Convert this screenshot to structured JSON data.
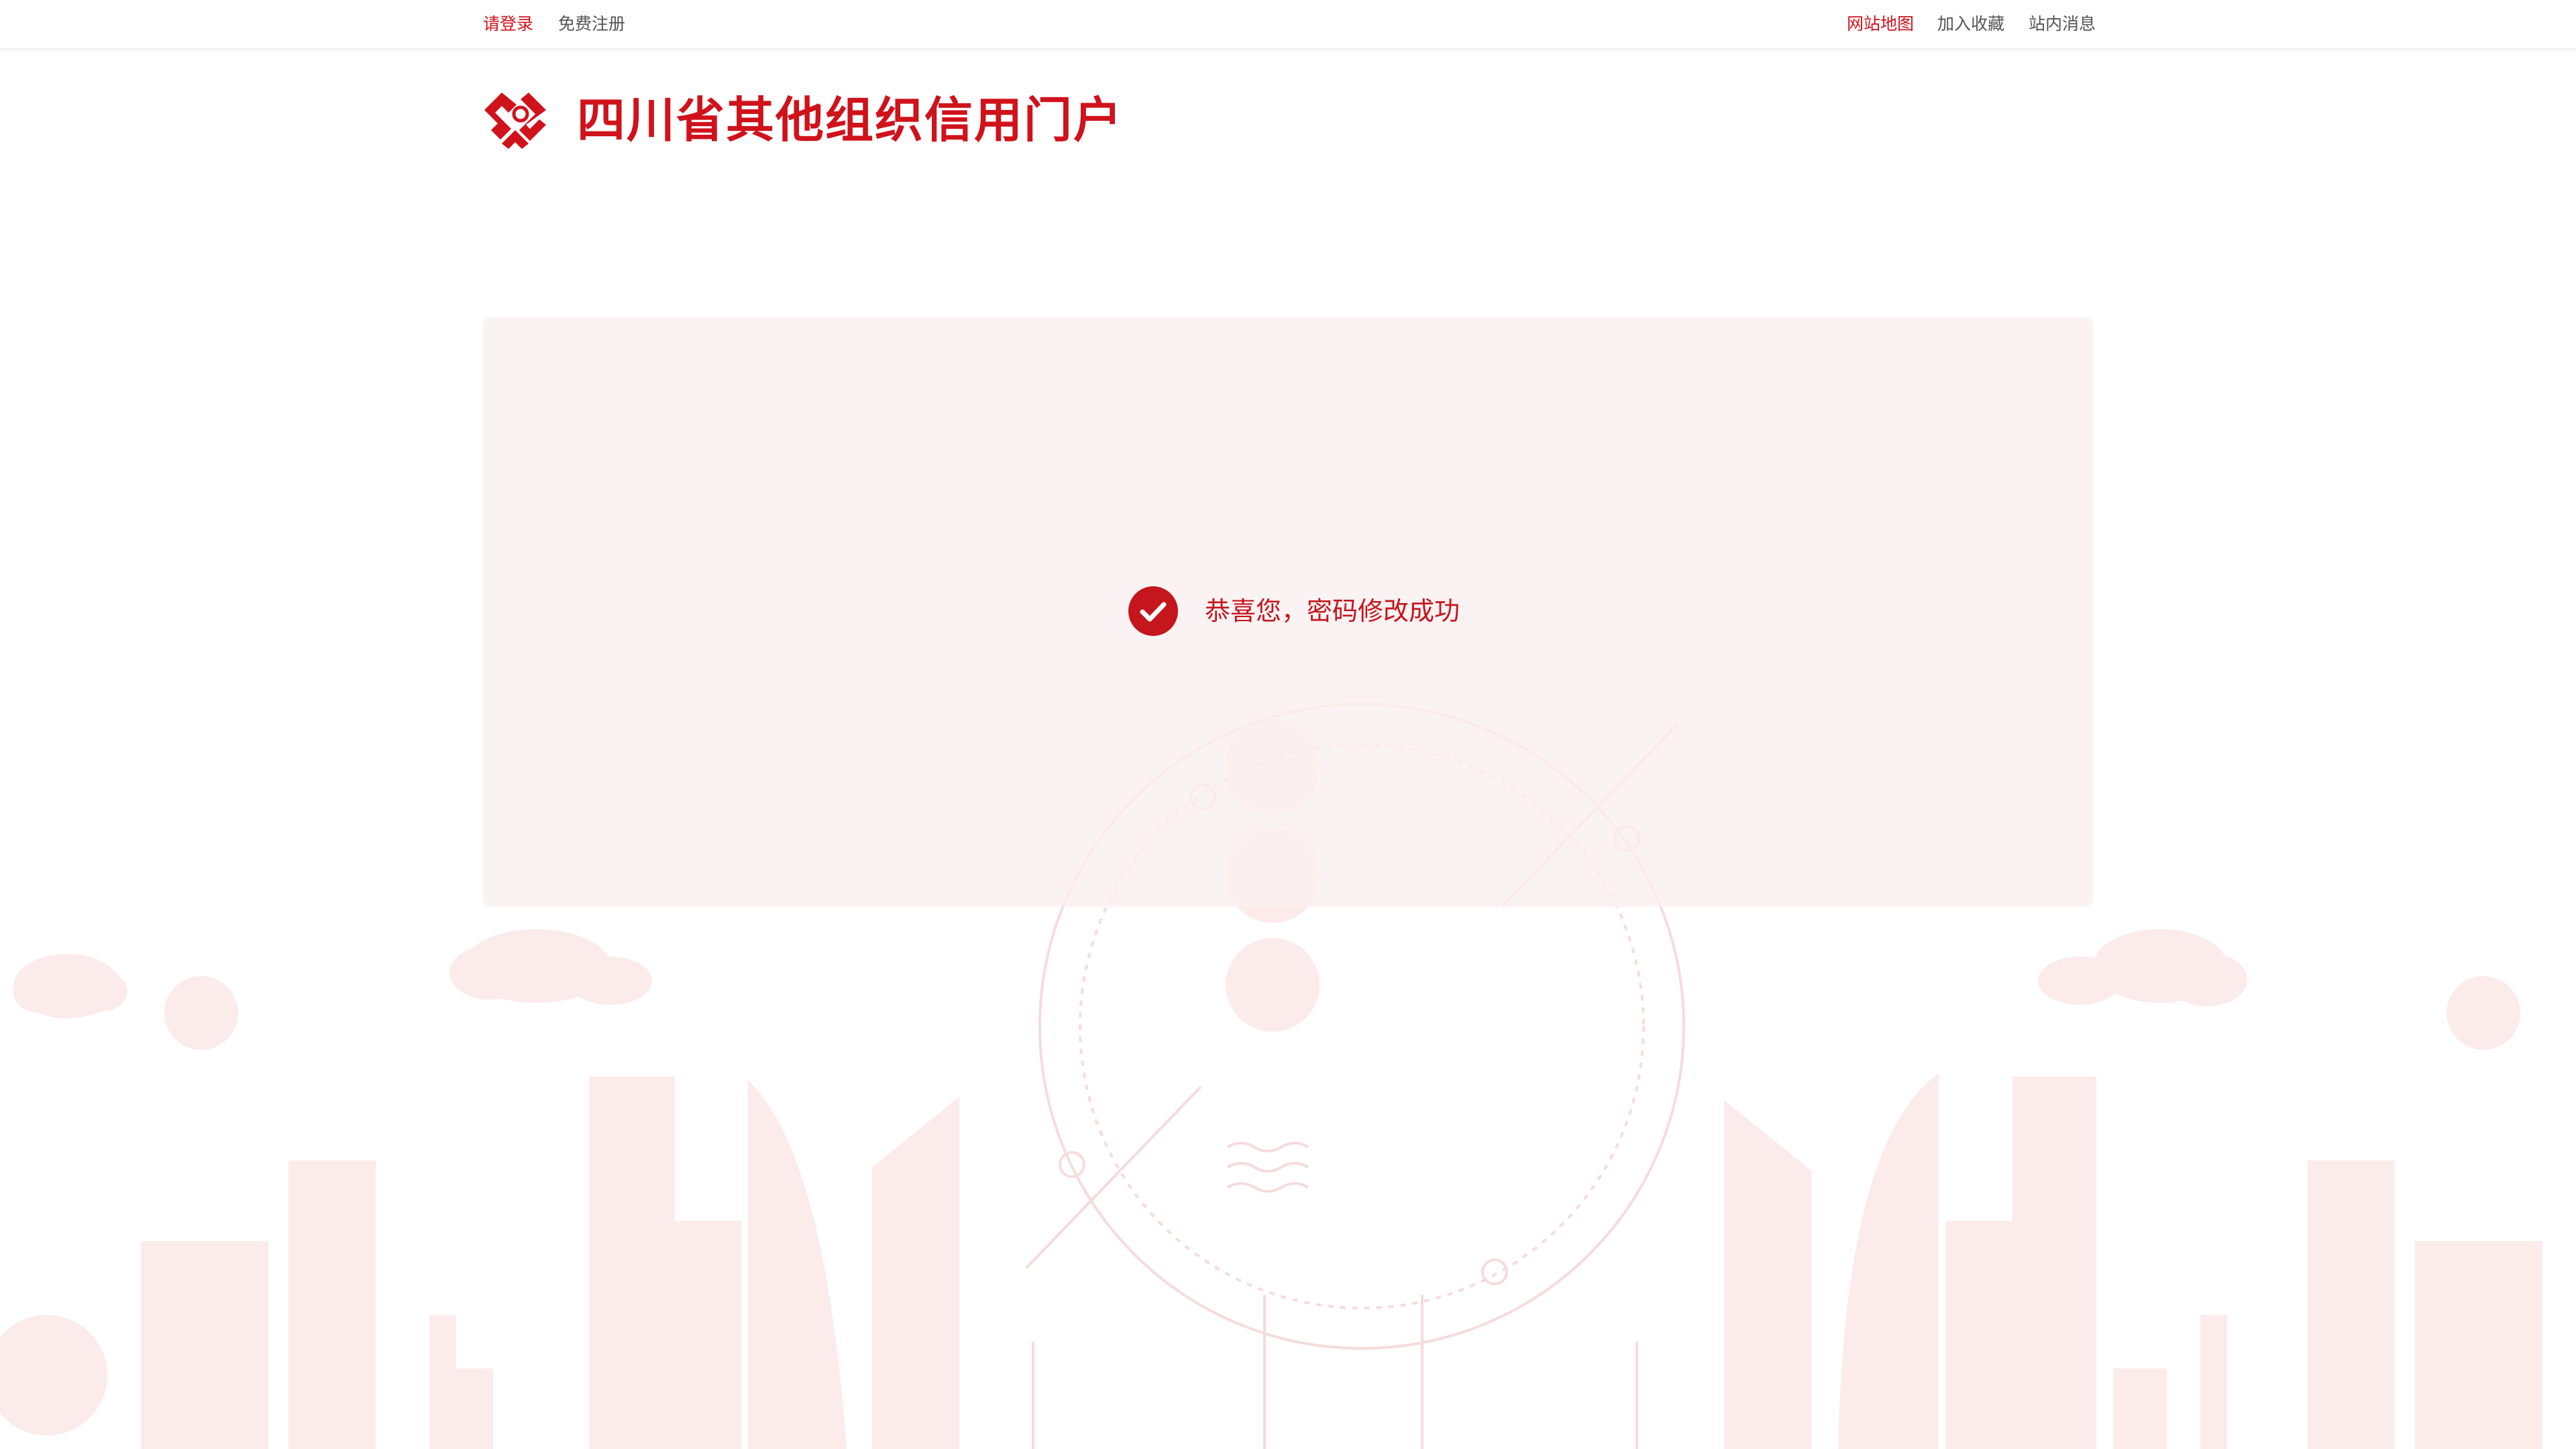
{
  "topbar": {
    "login_label": "请登录",
    "register_label": "免费注册",
    "sitemap_label": "网站地图",
    "bookmark_label": "加入收藏",
    "messages_label": "站内消息"
  },
  "header": {
    "logo_icon": "credit-logo-icon",
    "title": "四川省其他组织信用门户"
  },
  "main": {
    "status_icon": "check-circle-icon",
    "message": "恭喜您，密码修改成功"
  },
  "colors": {
    "accent": "#d0121b",
    "text_muted": "#555555",
    "panel_bg": "#fbf1f1",
    "illustration": "#fbe6e6"
  }
}
